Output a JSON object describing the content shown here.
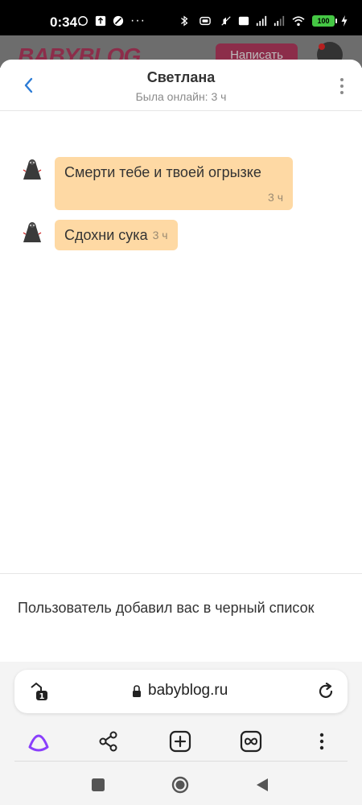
{
  "status_bar": {
    "time": "0:34",
    "battery": "100"
  },
  "background_site": {
    "logo": "BABYBLOG",
    "write_button": "Написать"
  },
  "chat": {
    "title": "Светлана",
    "subtitle": "Была онлайн: 3 ч",
    "messages": [
      {
        "text": "Смерти тебе и твоей огрызке",
        "time": "3 ч"
      },
      {
        "text": "Сдохни сука",
        "time": "3 ч"
      }
    ],
    "blocked_notice": "Пользователь добавил вас в черный список"
  },
  "browser": {
    "url": "babyblog.ru",
    "tab_count": "1"
  },
  "colors": {
    "bubble": "#fed9a4",
    "accent": "#2b7bd6",
    "alice": "#8a3ffc"
  },
  "icons": {
    "back": "chevron-left-icon",
    "more": "kebab-menu-icon",
    "tabs": "tabs-icon",
    "lock": "lock-icon",
    "reload": "reload-icon",
    "alice": "alice-assistant-icon",
    "share": "share-icon",
    "new_tab": "plus-square-icon",
    "infinity": "infinity-icon",
    "menu": "kebab-menu-icon"
  }
}
